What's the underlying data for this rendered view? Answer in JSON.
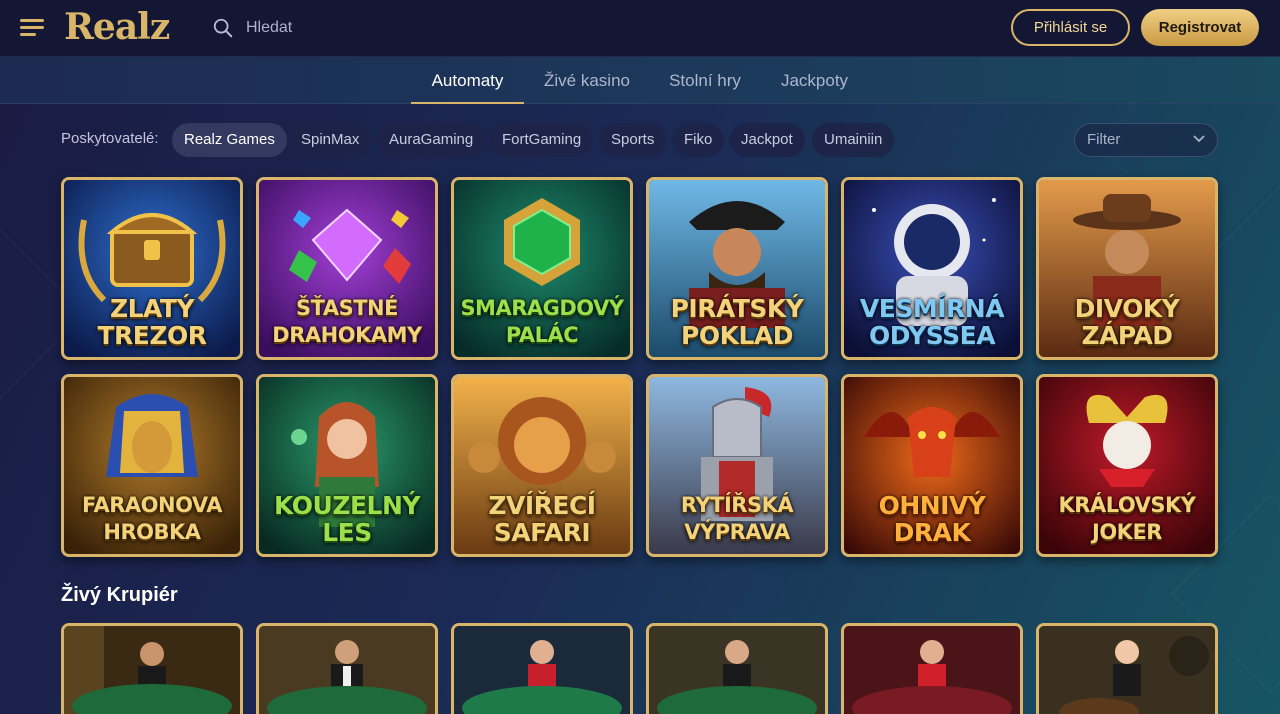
{
  "header": {
    "logo": "Realz",
    "search_placeholder": "Hledat",
    "login_label": "Přihlásit se",
    "register_label": "Registrovat"
  },
  "tabs": [
    {
      "label": "Automaty",
      "active": true
    },
    {
      "label": "Živé kasino",
      "active": false
    },
    {
      "label": "Stolní hry",
      "active": false
    },
    {
      "label": "Jackpoty",
      "active": false
    }
  ],
  "providers": {
    "label": "Poskytovatelé:",
    "chips": [
      "Realz Games",
      "SpinMax",
      "AuraGaming",
      "FortGaming",
      "Sports",
      "Fiko",
      "Jackpot",
      "Umainiin"
    ],
    "active": "Realz Games",
    "filter_label": "Filter"
  },
  "games": [
    {
      "line1": "ZLATÝ",
      "line2": "TREZOR",
      "icon": "treasure-chest"
    },
    {
      "line1": "ŠŤASTNÉ",
      "line2": "DRAHOKAMY",
      "icon": "gems"
    },
    {
      "line1": "SMARAGDOVÝ",
      "line2": "PALÁC",
      "icon": "emerald"
    },
    {
      "line1": "PIRÁTSKÝ",
      "line2": "POKLAD",
      "icon": "pirate"
    },
    {
      "line1": "VESMÍRNÁ",
      "line2": "ODYSSEA",
      "icon": "astronaut"
    },
    {
      "line1": "DIVOKÝ",
      "line2": "ZÁPAD",
      "icon": "cowboy"
    },
    {
      "line1": "FARAONOVA",
      "line2": "HROBKA",
      "icon": "pharaoh"
    },
    {
      "line1": "KOUZELNÝ",
      "line2": "LES",
      "icon": "fairy"
    },
    {
      "line1": "ZVÍŘECÍ",
      "line2": "SAFARI",
      "icon": "lion"
    },
    {
      "line1": "RYTÍŘSKÁ",
      "line2": "VÝPRAVA",
      "icon": "knight"
    },
    {
      "line1": "OHNIVÝ",
      "line2": "DRAK",
      "icon": "dragon"
    },
    {
      "line1": "KRÁLOVSKÝ",
      "line2": "JOKER",
      "icon": "joker"
    }
  ],
  "live": {
    "title": "Živý Krupiér",
    "tables": [
      "dealer-1",
      "dealer-2",
      "dealer-3",
      "dealer-4",
      "dealer-5",
      "dealer-6"
    ]
  },
  "colors": {
    "gold": "#d9b56a",
    "header_bg": "#141733",
    "register_bg": "#e2bb6c"
  }
}
